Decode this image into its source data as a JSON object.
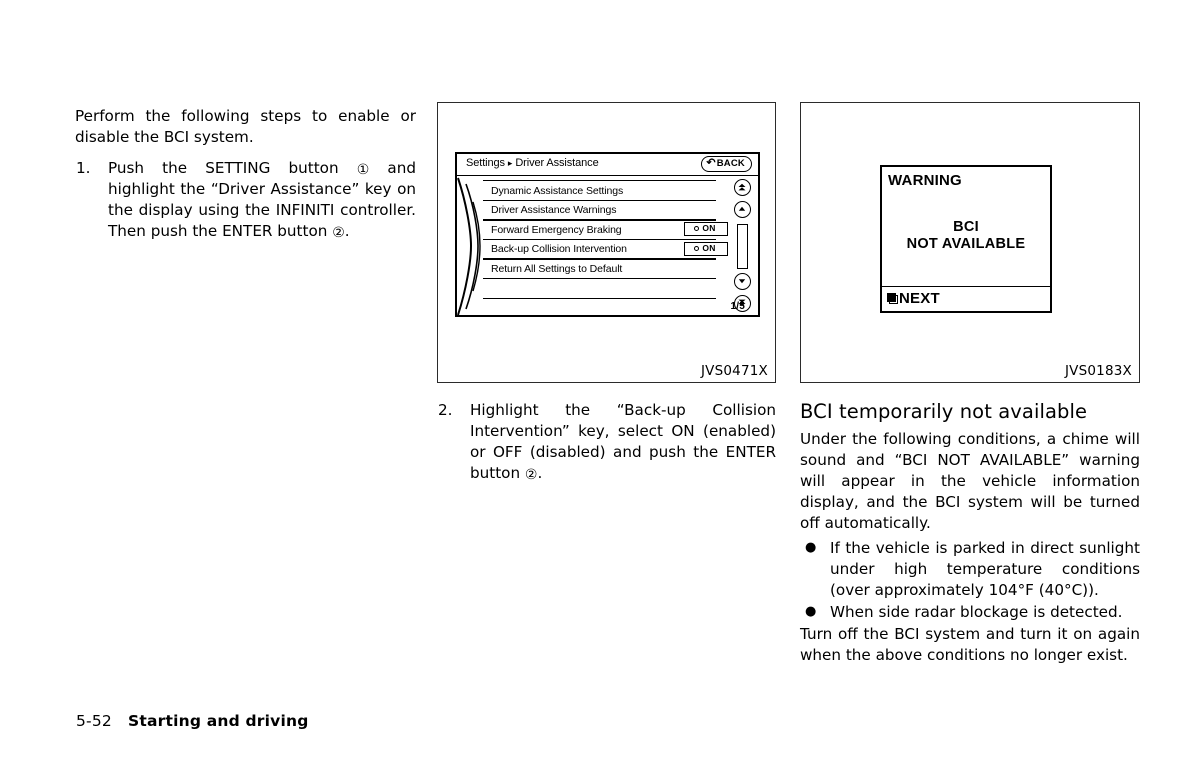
{
  "left_column": {
    "intro": "Perform the following steps to enable or disable the BCI system.",
    "steps": [
      {
        "num": "1.",
        "text_before_1": "Push the SETTING button ",
        "circle_1": "①",
        "text_mid": " and highlight the “Driver Assistance” key on the display using the INFINITI controller. Then push the ENTER button ",
        "circle_2": "②",
        "text_after": "."
      }
    ]
  },
  "middle_column": {
    "figure": {
      "caption": "JVS0471X",
      "nav_screen": {
        "header_title_left": "Settings",
        "header_arrow": "▸",
        "header_title_right": "Driver Assistance",
        "back_button": {
          "icon": "back-arrow-icon",
          "label": "BACK"
        },
        "rows": [
          {
            "label": "Dynamic Assistance Settings",
            "toggle": null
          },
          {
            "label": "Driver Assistance Warnings",
            "toggle": null
          },
          {
            "label": "Forward Emergency Braking",
            "toggle": "ON"
          },
          {
            "label": "Back-up Collision Intervention",
            "toggle": "ON"
          },
          {
            "label": "Return All Settings to Default",
            "toggle": null
          },
          {
            "label": "",
            "toggle": null
          }
        ],
        "page_indicator": "1/5",
        "controls": [
          {
            "name": "scroll-page-up",
            "icon": "double-chevron-up-icon"
          },
          {
            "name": "scroll-up",
            "icon": "chevron-up-icon"
          },
          {
            "name": "scrollbar-track",
            "icon": "scrollbar-track"
          },
          {
            "name": "scroll-down",
            "icon": "chevron-down-icon"
          },
          {
            "name": "scroll-page-down",
            "icon": "double-chevron-down-icon"
          }
        ]
      }
    },
    "steps": [
      {
        "num": "2.",
        "text_before": "Highlight the “Back-up Collision Intervention” key, select ON (enabled) or OFF (disabled) and push the ENTER button ",
        "circle_2": "②",
        "text_after": "."
      }
    ]
  },
  "right_column": {
    "figure": {
      "caption": "JVS0183X",
      "warning_screen": {
        "title": "WARNING",
        "message_line1": "BCI",
        "message_line2": "NOT AVAILABLE",
        "next_label": "NEXT",
        "next_icon": "next-square-icon"
      }
    },
    "heading": "BCI temporarily not available",
    "paragraph": "Under the following conditions, a chime will sound and “BCI NOT AVAILABLE” warning will appear in the vehicle information display, and the BCI system will be turned off automatically.",
    "bullets": [
      {
        "marker": "●",
        "text": "If the vehicle is parked in direct sunlight under high temperature conditions (over approximately 104°F (40°C))."
      },
      {
        "marker": "●",
        "text": "When side radar blockage is detected."
      }
    ],
    "closing": "Turn off the BCI system and turn it on again when the above conditions no longer exist."
  },
  "footer": {
    "page_number": "5-52",
    "chapter": "Starting and driving"
  }
}
